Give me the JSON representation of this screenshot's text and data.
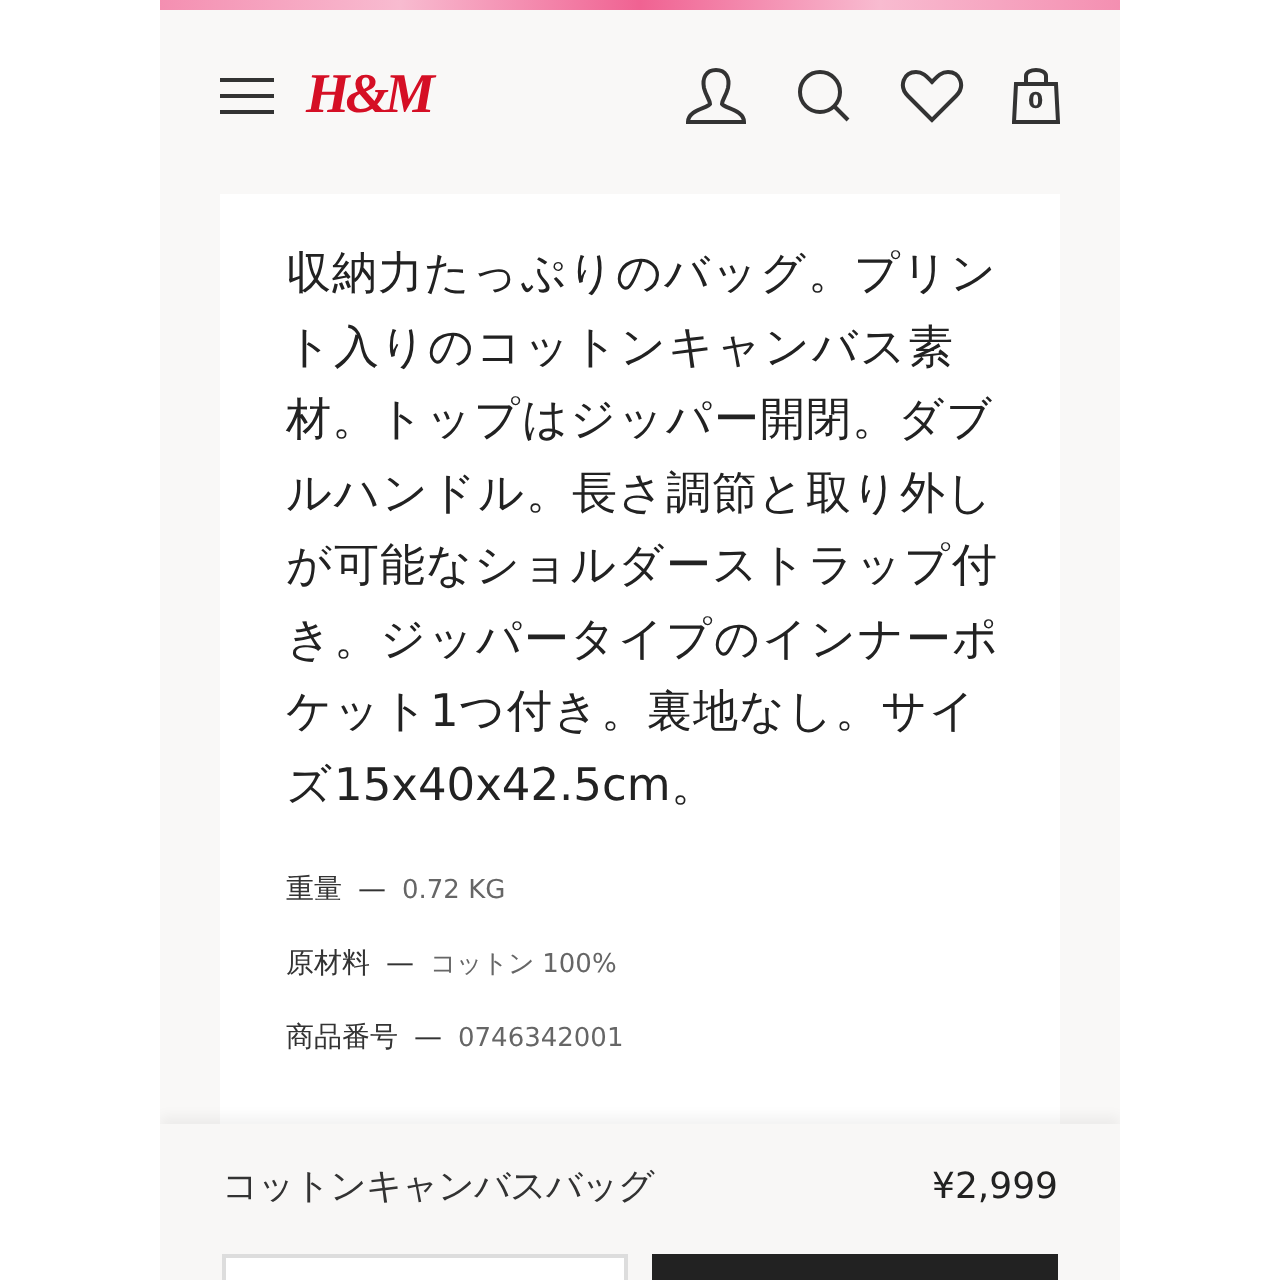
{
  "header": {
    "logo": "H&M",
    "bag_count": "0"
  },
  "description": "収納力たっぷりのバッグ。プリント入りのコットンキャンバス素材。トップはジッパー開閉。ダブルハンドル。長さ調節と取り外しが可能なショルダーストラップ付き。ジッパータイプのインナーポケット1つ付き。裏地なし。サイズ15x40x42.5cm。",
  "details": [
    {
      "label": "重量",
      "dash": "—",
      "value": "0.72 KG"
    },
    {
      "label": "原材料",
      "dash": "—",
      "value": "コットン 100%"
    },
    {
      "label": "商品番号",
      "dash": "—",
      "value": "0746342001"
    }
  ],
  "footer": {
    "product_name": "コットンキャンバスバッグ",
    "price": "¥2,999"
  }
}
